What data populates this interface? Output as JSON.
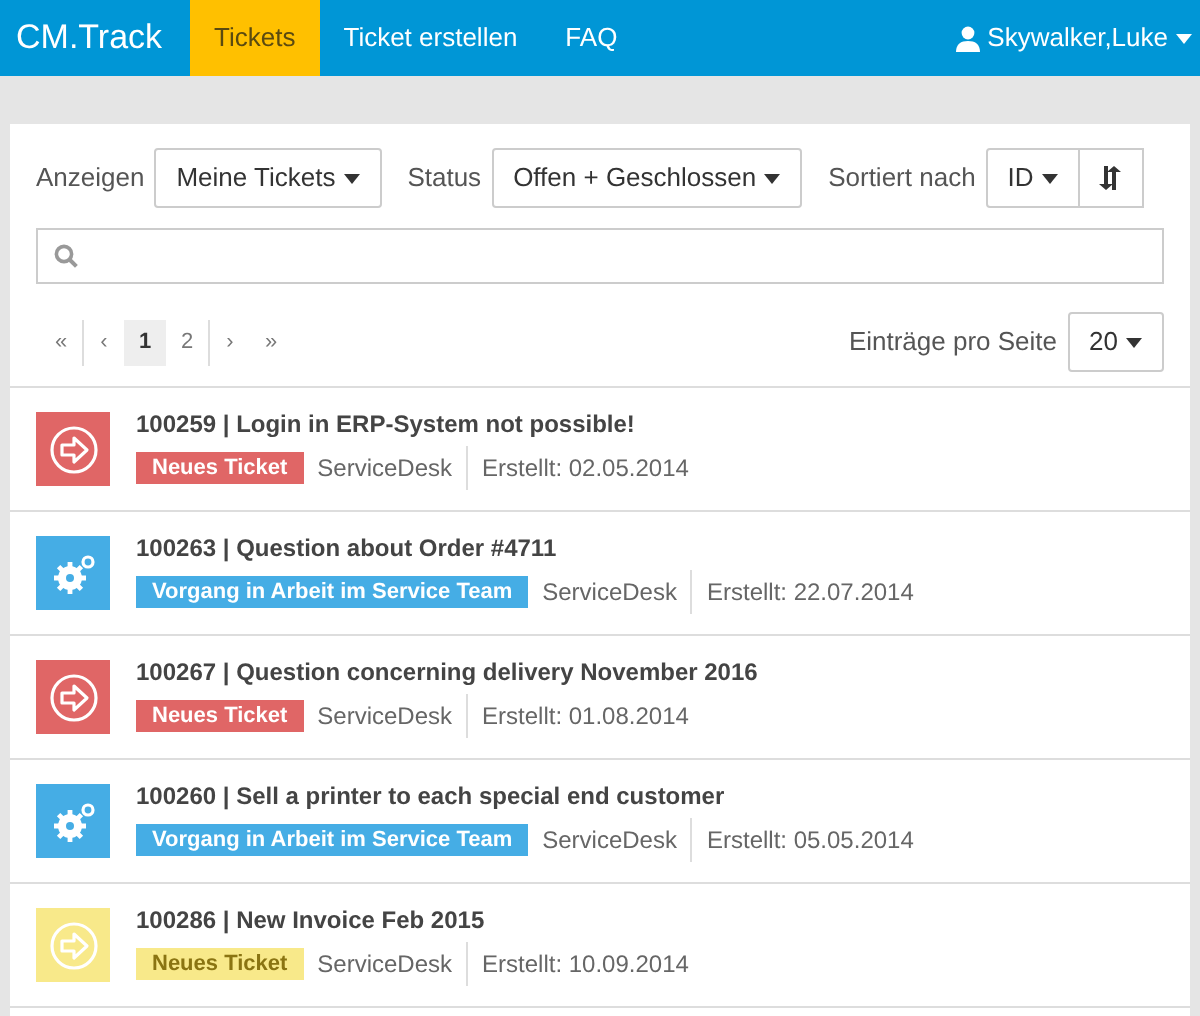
{
  "navbar": {
    "brand": "CM.Track",
    "items": [
      {
        "label": "Tickets",
        "selected": true
      },
      {
        "label": "Ticket erstellen",
        "selected": false
      },
      {
        "label": "FAQ",
        "selected": false
      }
    ],
    "user": "Skywalker,Luke"
  },
  "filters": {
    "show_label": "Anzeigen",
    "show_value": "Meine Tickets",
    "status_label": "Status",
    "status_value": "Offen + Geschlossen",
    "sort_label": "Sortiert nach",
    "sort_value": "ID"
  },
  "pagination": [
    {
      "label": "«",
      "selected": false
    },
    {
      "label": "‹",
      "selected": false
    },
    {
      "label": "1",
      "selected": true
    },
    {
      "label": "2",
      "selected": false
    },
    {
      "label": "›",
      "selected": false
    },
    {
      "label": "»",
      "selected": false
    }
  ],
  "per_page": {
    "label": "Einträge pro Seite",
    "value": "20"
  },
  "tickets": [
    {
      "title": "100259 | Login in ERP-System not possible!",
      "status": "Neues Ticket",
      "kind": "new",
      "color": "#e06666",
      "queue": "ServiceDesk",
      "created": "Erstellt: 02.05.2014"
    },
    {
      "title": "100263 | Question about Order #4711",
      "status": "Vorgang in Arbeit im Service Team",
      "kind": "in_progress",
      "color": "#45ade5",
      "queue": "ServiceDesk",
      "created": "Erstellt: 22.07.2014"
    },
    {
      "title": "100267 | Question concerning delivery November 2016",
      "status": "Neues Ticket",
      "kind": "new",
      "color": "#e06666",
      "queue": "ServiceDesk",
      "created": "Erstellt: 01.08.2014"
    },
    {
      "title": "100260 | Sell a printer to each special end customer",
      "status": "Vorgang in Arbeit im Service Team",
      "kind": "in_progress",
      "color": "#45ade5",
      "queue": "ServiceDesk",
      "created": "Erstellt: 05.05.2014"
    },
    {
      "title": "100286 | New Invoice Feb 2015",
      "status": "Neues Ticket",
      "kind": "new",
      "color": "#f8e98a",
      "queue": "ServiceDesk",
      "created": "Erstellt: 10.09.2014"
    }
  ]
}
